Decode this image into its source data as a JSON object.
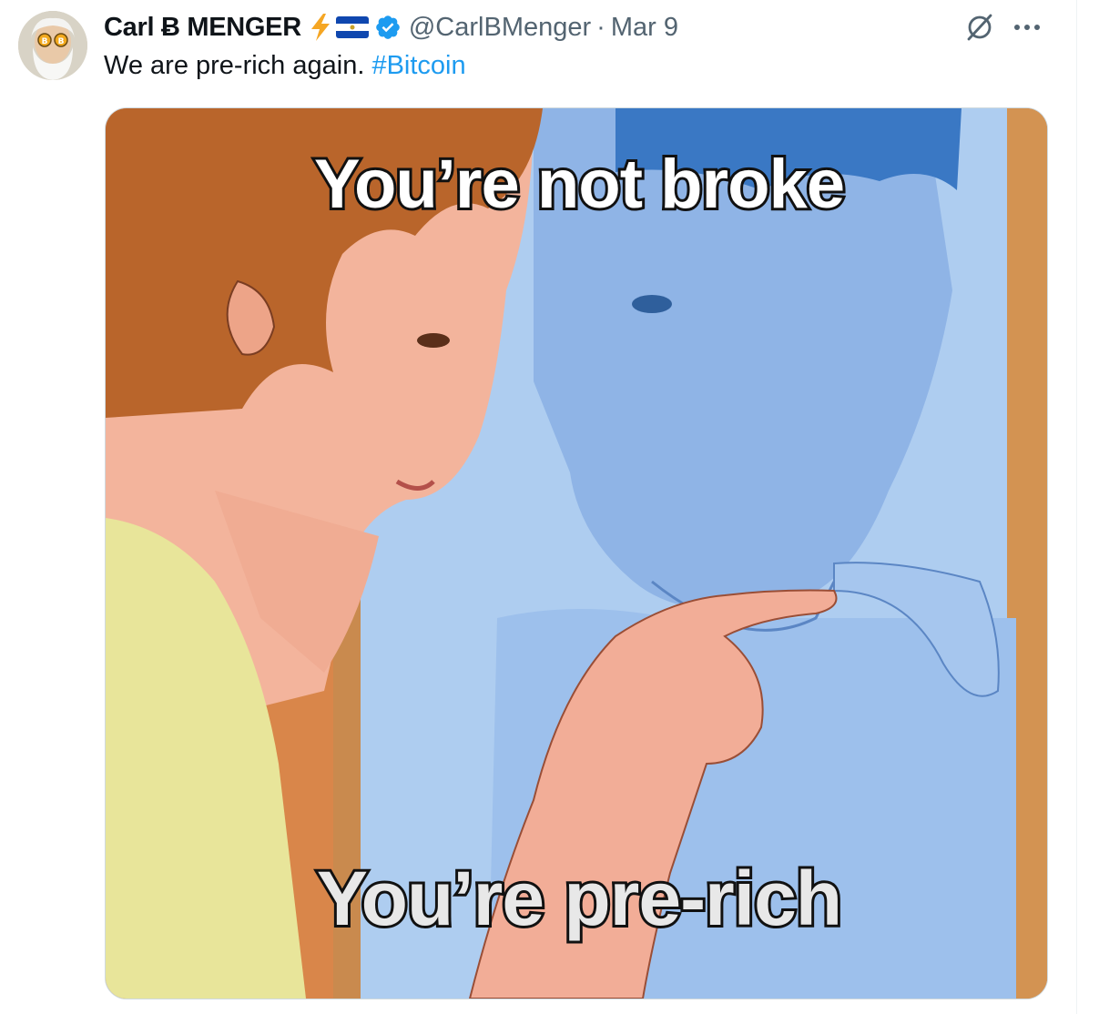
{
  "tweet": {
    "author_name": "Carl Ƀ MENGER",
    "handle": "@CarlBMenger",
    "separator": "·",
    "date": "Mar 9",
    "text": "We are pre-rich again.",
    "hashtag": "#Bitcoin",
    "badge_emojis": [
      "lightning-emoji",
      "el-salvador-flag-emoji"
    ],
    "verified": true,
    "more_label": "···"
  },
  "media": {
    "caption_top": "You’re not broke",
    "caption_bottom": "You’re pre-rich"
  },
  "colors": {
    "link": "#1d9bf0",
    "secondary_text": "#536471",
    "verified": "#1d9bf0"
  }
}
